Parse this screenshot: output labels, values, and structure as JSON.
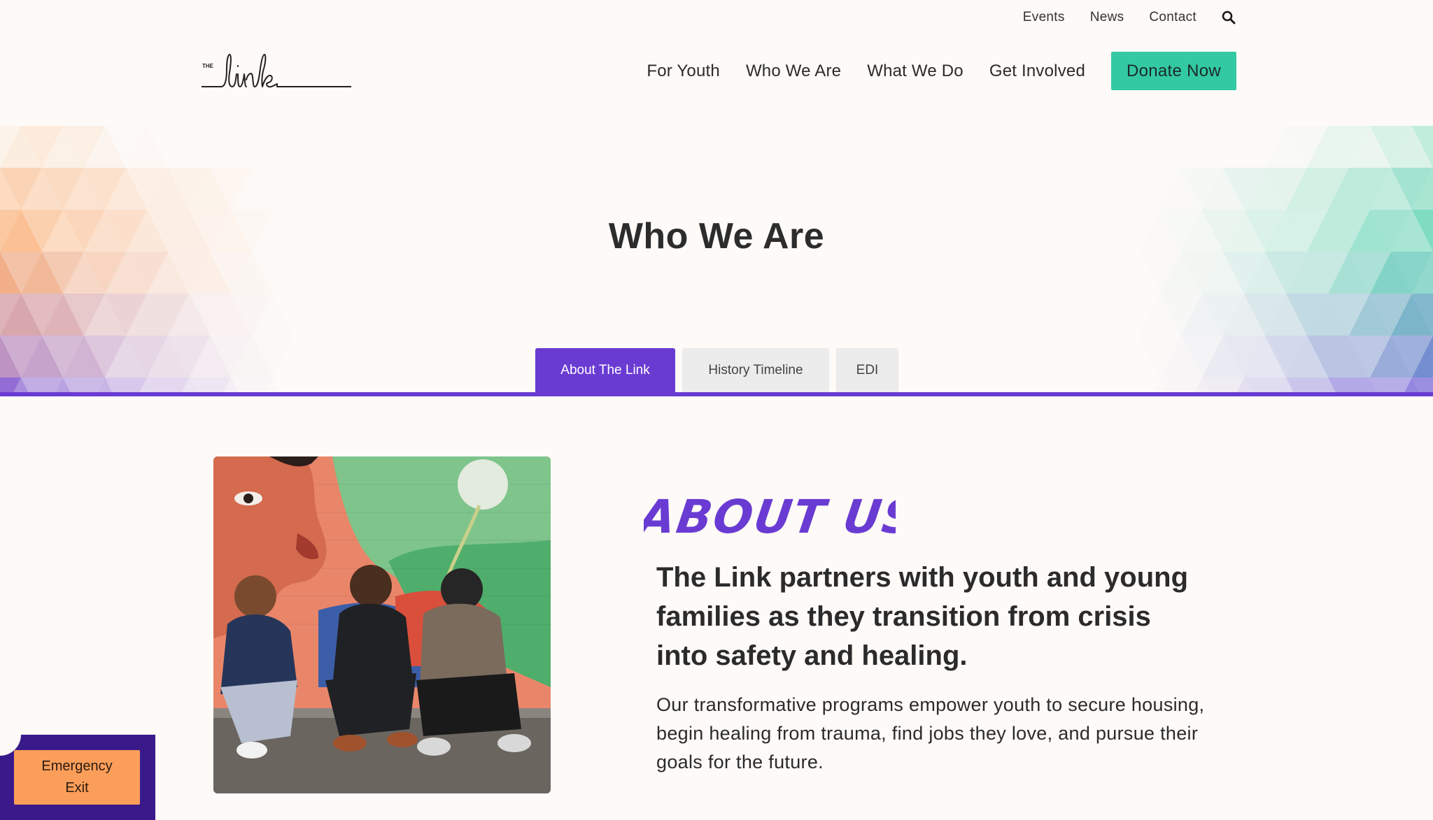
{
  "utility_nav": {
    "items": [
      "Events",
      "News",
      "Contact"
    ],
    "search_icon": "search-icon"
  },
  "logo": {
    "small_text": "THE",
    "word": "link"
  },
  "main_nav": {
    "items": [
      "For Youth",
      "Who We Are",
      "What We Do",
      "Get Involved"
    ],
    "donate_label": "Donate Now"
  },
  "hero": {
    "title": "Who We Are",
    "tabs": [
      "About The Link",
      "History Timeline",
      "EDI"
    ],
    "active_tab": "About The Link"
  },
  "about": {
    "heading": "ABOUT US",
    "lead": "The Link partners with youth and young families as they transition from crisis into safety and healing.",
    "body": "Our transformative programs empower youth to secure housing, begin healing from trauma, find jobs they love, and pursue their goals for the future."
  },
  "emergency_exit": {
    "label": "Emergency\nExit"
  },
  "colors": {
    "accent_purple": "#6a3bd2",
    "donate_green": "#33c9a3",
    "exit_orange": "#fb9e5a",
    "exit_bg": "#3a1a8a"
  }
}
